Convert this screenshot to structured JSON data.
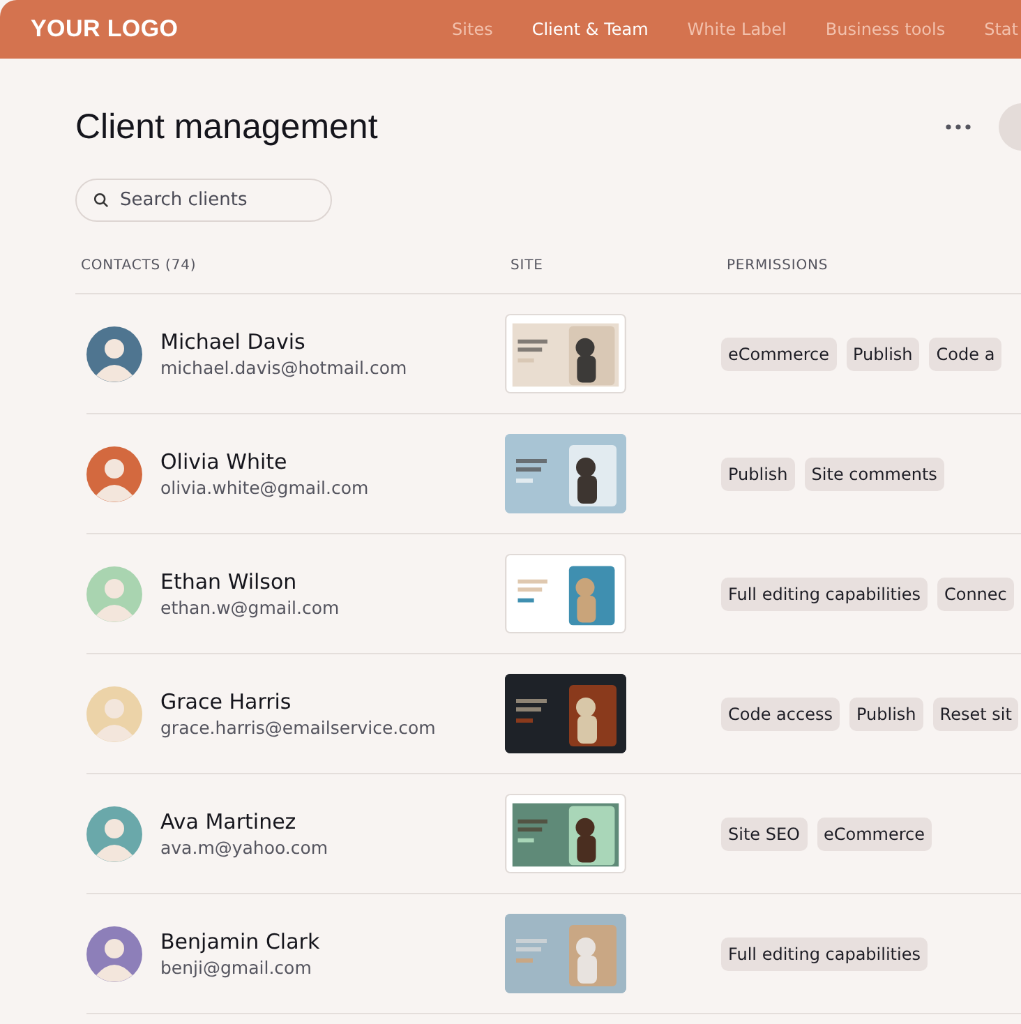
{
  "logo": "YOUR LOGO",
  "nav": [
    {
      "label": "Sites",
      "selected": false
    },
    {
      "label": "Client & Team",
      "selected": true
    },
    {
      "label": "White Label",
      "selected": false
    },
    {
      "label": "Business tools",
      "selected": false
    },
    {
      "label": "Stat",
      "selected": false
    }
  ],
  "page_title": "Client management",
  "search": {
    "placeholder": "Search clients"
  },
  "table": {
    "columns": [
      "CONTACTS (74)",
      "SITE",
      "PERMISSIONS"
    ],
    "rows": [
      {
        "name": "Michael Davis",
        "email": "michael.davis@hotmail.com",
        "site": {
          "kind": "picture"
        },
        "permissions": [
          "eCommerce",
          "Publish",
          "Code a"
        ]
      },
      {
        "name": "Olivia White",
        "email": "olivia.white@gmail.com",
        "site": {
          "kind": "picture"
        },
        "permissions": [
          "Publish",
          "Site comments"
        ]
      },
      {
        "name": "Ethan Wilson",
        "email": "ethan.w@gmail.com",
        "site": {
          "kind": "picture"
        },
        "permissions": [
          "Full editing capabilities",
          "Connec"
        ]
      },
      {
        "name": "Grace Harris",
        "email": "grace.harris@emailservice.com",
        "site": {
          "kind": "picture"
        },
        "permissions": [
          "Code access",
          "Publish",
          "Reset sit"
        ]
      },
      {
        "name": "Ava Martinez",
        "email": "ava.m@yahoo.com",
        "site": {
          "kind": "picture"
        },
        "permissions": [
          "Site SEO",
          "eCommerce"
        ]
      },
      {
        "name": "Benjamin Clark",
        "email": "benji@gmail.com",
        "site": {
          "kind": "picture"
        },
        "permissions": [
          "Full editing capabilities"
        ]
      }
    ]
  }
}
